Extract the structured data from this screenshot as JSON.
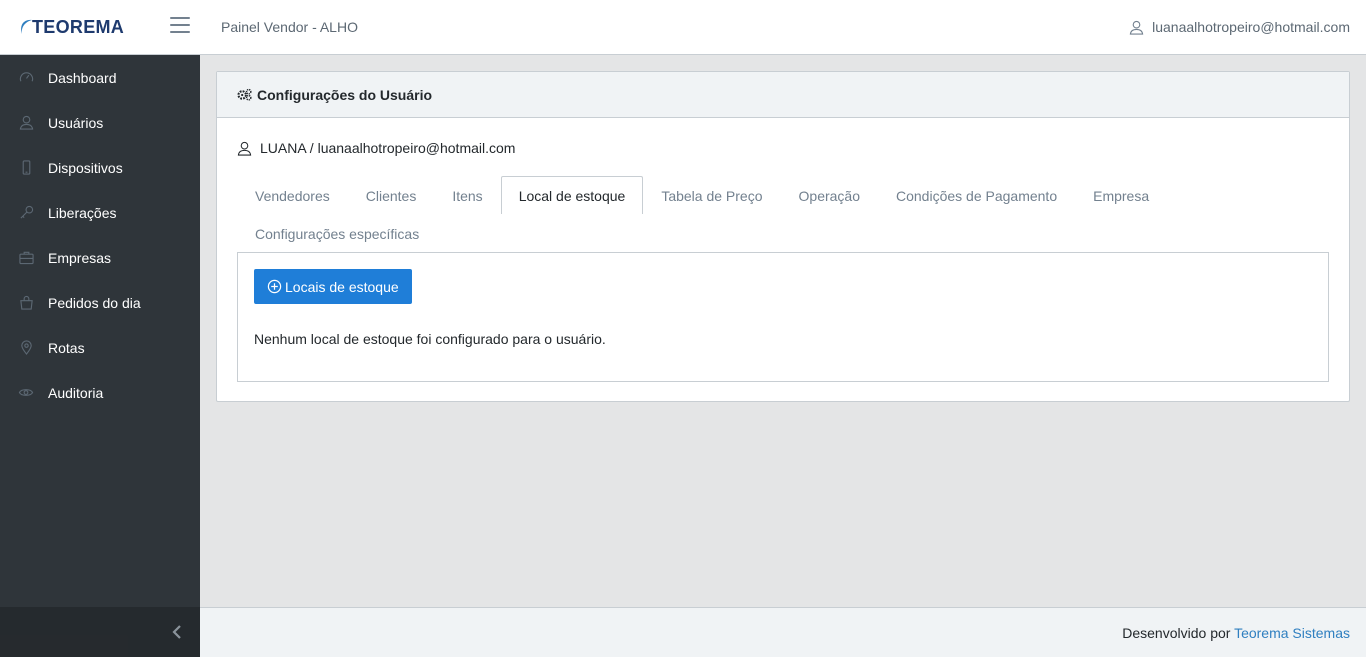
{
  "header": {
    "logo_text": "TEOREMA",
    "app_title": "Painel Vendor - ALHO",
    "user_email": "luanaalhotropeiro@hotmail.com"
  },
  "sidebar": {
    "items": [
      {
        "label": "Dashboard",
        "icon": "speedometer-icon"
      },
      {
        "label": "Usuários",
        "icon": "user-icon"
      },
      {
        "label": "Dispositivos",
        "icon": "phone-icon"
      },
      {
        "label": "Liberações",
        "icon": "key-icon"
      },
      {
        "label": "Empresas",
        "icon": "briefcase-icon"
      },
      {
        "label": "Pedidos do dia",
        "icon": "bag-icon"
      },
      {
        "label": "Rotas",
        "icon": "location-pin-icon"
      },
      {
        "label": "Auditoria",
        "icon": "eye-icon"
      }
    ]
  },
  "card": {
    "title": "Configurações do Usuário",
    "user_line": "LUANA / luanaalhotropeiro@hotmail.com"
  },
  "tabs": [
    {
      "label": "Vendedores"
    },
    {
      "label": "Clientes"
    },
    {
      "label": "Itens"
    },
    {
      "label": "Local de estoque",
      "active": true
    },
    {
      "label": "Tabela de Preço"
    },
    {
      "label": "Operação"
    },
    {
      "label": "Condições de Pagamento"
    },
    {
      "label": "Empresa"
    },
    {
      "label": "Configurações específicas"
    }
  ],
  "content": {
    "add_button_label": "Locais de estoque",
    "empty_message": "Nenhum local de estoque foi configurado para o usuário."
  },
  "footer": {
    "text": "Desenvolvido por",
    "link_text": "Teorema Sistemas"
  },
  "colors": {
    "sidebar_bg": "#2f353a",
    "primary_button": "#1f7ed8",
    "link": "#2f7fc0"
  }
}
